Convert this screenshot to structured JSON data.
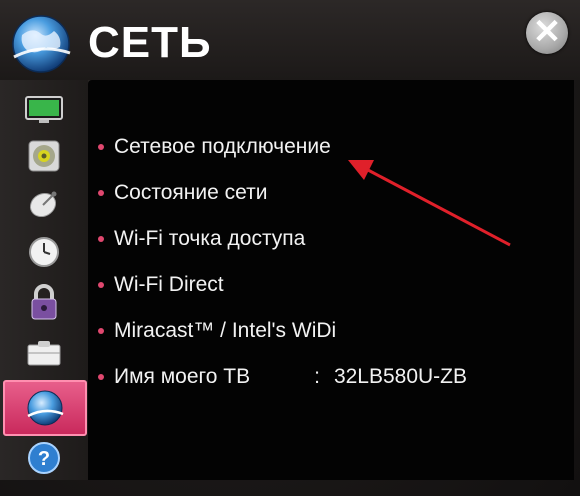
{
  "header": {
    "title": "СЕТЬ",
    "close_label": "✕"
  },
  "sidebar": {
    "items": [
      {
        "icon": "picture-icon"
      },
      {
        "icon": "speaker-icon"
      },
      {
        "icon": "satellite-dish-icon"
      },
      {
        "icon": "clock-icon"
      },
      {
        "icon": "lock-icon"
      },
      {
        "icon": "options-icon"
      },
      {
        "icon": "network-globe-icon",
        "active": true
      },
      {
        "icon": "help-icon"
      }
    ]
  },
  "menu": {
    "items": [
      {
        "label": "Сетевое подключение"
      },
      {
        "label": "Состояние сети"
      },
      {
        "label": "Wi-Fi точка доступа"
      },
      {
        "label": "Wi-Fi Direct"
      },
      {
        "label": "Miracast™ / Intel's WiDi"
      }
    ],
    "tv_name": {
      "label": "Имя моего ТВ",
      "separator": ":",
      "value": "32LB580U-ZB"
    }
  },
  "colors": {
    "accent": "#c9295c",
    "bullet": "#e0486f",
    "annotation_arrow": "#e0202a"
  }
}
